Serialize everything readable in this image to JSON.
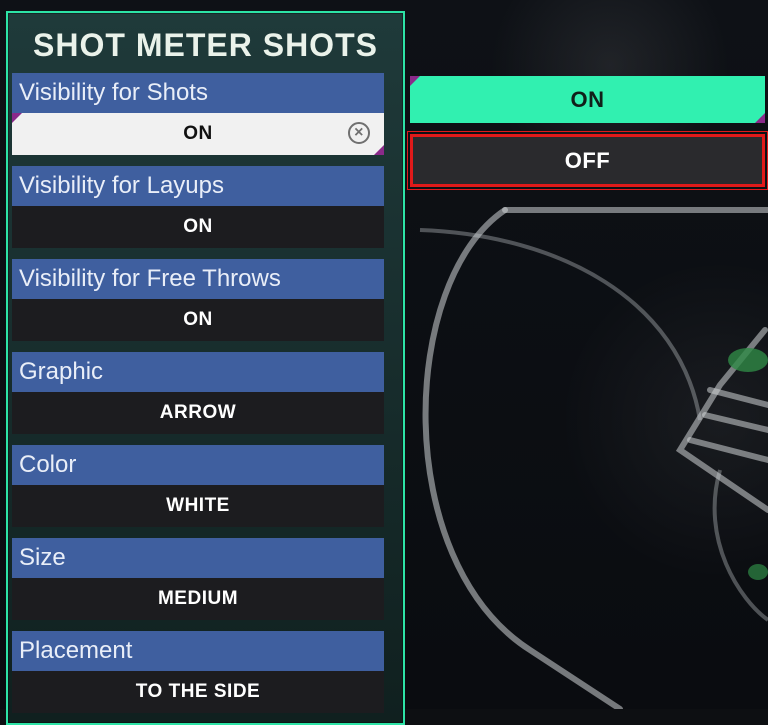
{
  "panel": {
    "title": "SHOT METER SHOTS",
    "settings": [
      {
        "label": "Visibility for Shots",
        "value": "ON"
      },
      {
        "label": "Visibility for Layups",
        "value": "ON"
      },
      {
        "label": "Visibility for Free Throws",
        "value": "ON"
      },
      {
        "label": "Graphic",
        "value": "ARROW"
      },
      {
        "label": "Color",
        "value": "WHITE"
      },
      {
        "label": "Size",
        "value": "MEDIUM"
      },
      {
        "label": "Placement",
        "value": "TO THE SIDE"
      }
    ]
  },
  "options": {
    "on": "ON",
    "off": "OFF"
  },
  "colors": {
    "accent_green": "#31f0b0",
    "label_blue": "#3f5f9f",
    "highlight_red": "#e01a1a",
    "panel_border": "#2de3a6"
  }
}
